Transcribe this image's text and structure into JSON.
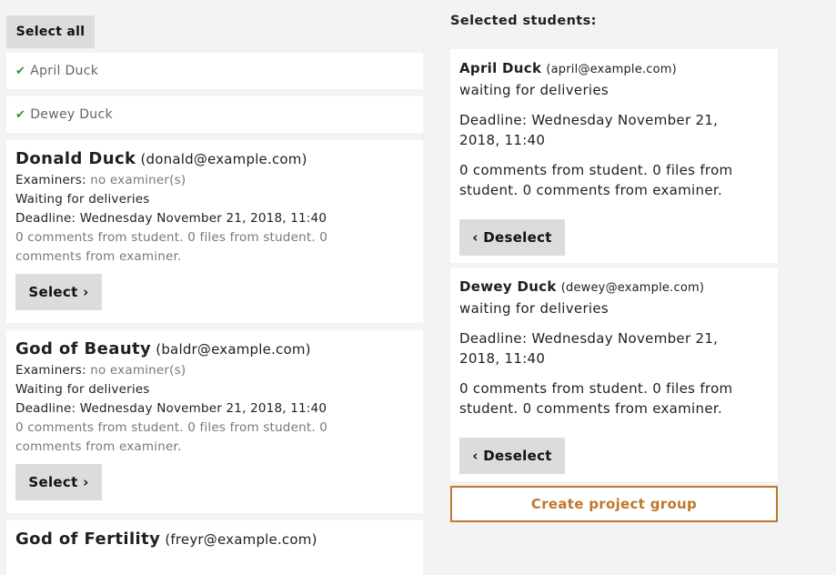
{
  "left": {
    "select_all_label": "Select all",
    "selected_compact": [
      {
        "name": "April Duck"
      },
      {
        "name": "Dewey Duck"
      }
    ],
    "students": [
      {
        "name": "Donald Duck",
        "email": "(donald@example.com)",
        "examiners_label": "Examiners:",
        "examiners_value": "no examiner(s)",
        "status": "Waiting for deliveries",
        "deadline": "Deadline: Wednesday November 21, 2018, 11:40",
        "comments": "0 comments from student. 0 files from student. 0 comments from examiner.",
        "select_label": "Select"
      },
      {
        "name": "God of Beauty",
        "email": "(baldr@example.com)",
        "examiners_label": "Examiners:",
        "examiners_value": "no examiner(s)",
        "status": "Waiting for deliveries",
        "deadline": "Deadline: Wednesday November 21, 2018, 11:40",
        "comments": "0 comments from student. 0 files from student. 0 comments from examiner.",
        "select_label": "Select"
      },
      {
        "name": "God of Fertility",
        "email": "(freyr@example.com)"
      }
    ]
  },
  "right": {
    "heading": "Selected students:",
    "selected": [
      {
        "name": "April Duck",
        "email": "(april@example.com)",
        "status": "waiting for deliveries",
        "deadline": "Deadline: Wednesday November 21, 2018, 11:40",
        "comments": "0 comments from student. 0 files from student. 0 comments from examiner.",
        "deselect_label": "Deselect"
      },
      {
        "name": "Dewey Duck",
        "email": "(dewey@example.com)",
        "status": "waiting for deliveries",
        "deadline": "Deadline: Wednesday November 21, 2018, 11:40",
        "comments": "0 comments from student. 0 files from student. 0 comments from examiner.",
        "deselect_label": "Deselect"
      }
    ],
    "create_label": "Create project group"
  },
  "icons": {
    "check": "check-icon",
    "chevron_right": "chevron-right-icon",
    "chevron_left": "chevron-left-icon"
  },
  "colors": {
    "check": "#2e8b3d",
    "create_border": "#c0772a"
  }
}
